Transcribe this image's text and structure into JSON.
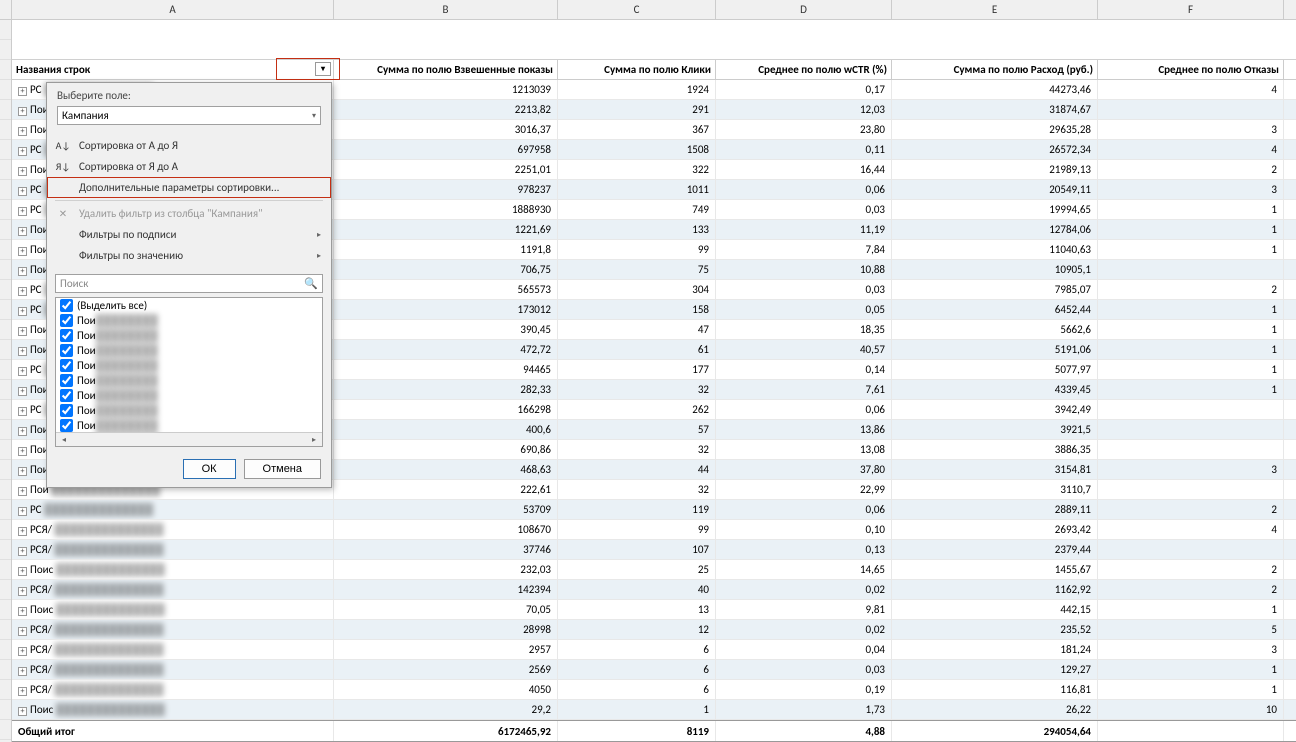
{
  "col_letters": [
    "",
    "A",
    "B",
    "C",
    "D",
    "E",
    "F"
  ],
  "col_widths": [
    "12px",
    "322px",
    "224px",
    "158px",
    "176px",
    "206px",
    "186px"
  ],
  "pivot_header": {
    "row_labels": "Названия строк",
    "B": "Сумма по полю Взвешенные показы",
    "C": "Сумма по полю Клики",
    "D": "Среднее по полю wCTR (%)",
    "E": "Сумма по полю Расход (руб.)",
    "F": "Среднее по полю Отказы"
  },
  "rows": [
    {
      "a": "РС",
      "v": [
        "1213039",
        "1924",
        "0,17",
        "44273,46",
        "4"
      ]
    },
    {
      "a": "Пои",
      "v": [
        "2213,82",
        "291",
        "12,03",
        "31874,67",
        ""
      ]
    },
    {
      "a": "Пои",
      "v": [
        "3016,37",
        "367",
        "23,80",
        "29635,28",
        "3"
      ]
    },
    {
      "a": "РС",
      "v": [
        "697958",
        "1508",
        "0,11",
        "26572,34",
        "4"
      ]
    },
    {
      "a": "Пои",
      "v": [
        "2251,01",
        "322",
        "16,44",
        "21989,13",
        "2"
      ]
    },
    {
      "a": "РС",
      "v": [
        "978237",
        "1011",
        "0,06",
        "20549,11",
        "3"
      ]
    },
    {
      "a": "РС",
      "v": [
        "1888930",
        "749",
        "0,03",
        "19994,65",
        "1"
      ]
    },
    {
      "a": "Пои",
      "v": [
        "1221,69",
        "133",
        "11,19",
        "12784,06",
        "1"
      ]
    },
    {
      "a": "Пои",
      "v": [
        "1191,8",
        "99",
        "7,84",
        "11040,63",
        "1"
      ]
    },
    {
      "a": "Пои",
      "v": [
        "706,75",
        "75",
        "10,88",
        "10905,1",
        ""
      ]
    },
    {
      "a": "РС",
      "v": [
        "565573",
        "304",
        "0,03",
        "7985,07",
        "2"
      ]
    },
    {
      "a": "РС",
      "v": [
        "173012",
        "158",
        "0,05",
        "6452,44",
        "1"
      ]
    },
    {
      "a": "Пои",
      "v": [
        "390,45",
        "47",
        "18,35",
        "5662,6",
        "1"
      ]
    },
    {
      "a": "Пои",
      "v": [
        "472,72",
        "61",
        "40,57",
        "5191,06",
        "1"
      ]
    },
    {
      "a": "РС",
      "v": [
        "94465",
        "177",
        "0,14",
        "5077,97",
        "1"
      ]
    },
    {
      "a": "Пои",
      "v": [
        "282,33",
        "32",
        "7,61",
        "4339,45",
        "1"
      ]
    },
    {
      "a": "РС",
      "v": [
        "166298",
        "262",
        "0,06",
        "3942,49",
        ""
      ]
    },
    {
      "a": "Пои",
      "v": [
        "400,6",
        "57",
        "13,86",
        "3921,5",
        ""
      ]
    },
    {
      "a": "Пои",
      "v": [
        "690,86",
        "32",
        "13,08",
        "3886,35",
        ""
      ]
    },
    {
      "a": "Пои",
      "v": [
        "468,63",
        "44",
        "37,80",
        "3154,81",
        "3"
      ]
    },
    {
      "a": "Пои",
      "v": [
        "222,61",
        "32",
        "22,99",
        "3110,7",
        ""
      ]
    },
    {
      "a": "РС",
      "v": [
        "53709",
        "119",
        "0,06",
        "2889,11",
        "2"
      ]
    },
    {
      "a": "РСЯ/",
      "v": [
        "108670",
        "99",
        "0,10",
        "2693,42",
        "4"
      ]
    },
    {
      "a": "РСЯ/",
      "v": [
        "37746",
        "107",
        "0,13",
        "2379,44",
        ""
      ]
    },
    {
      "a": "Поис",
      "v": [
        "232,03",
        "25",
        "14,65",
        "1455,67",
        "2"
      ]
    },
    {
      "a": "РСЯ/",
      "v": [
        "142394",
        "40",
        "0,02",
        "1162,92",
        "2"
      ]
    },
    {
      "a": "Поис",
      "v": [
        "70,05",
        "13",
        "9,81",
        "442,15",
        "1"
      ]
    },
    {
      "a": "РСЯ/",
      "v": [
        "28998",
        "12",
        "0,02",
        "235,52",
        "5"
      ]
    },
    {
      "a": "РСЯ/",
      "v": [
        "2957",
        "6",
        "0,04",
        "181,24",
        "3"
      ]
    },
    {
      "a": "РСЯ/",
      "v": [
        "2569",
        "6",
        "0,03",
        "129,27",
        "1"
      ]
    },
    {
      "a": "РСЯ/",
      "v": [
        "4050",
        "6",
        "0,19",
        "116,81",
        "1"
      ]
    },
    {
      "a": "Поис",
      "v": [
        "29,2",
        "1",
        "1,73",
        "26,22",
        "10"
      ]
    }
  ],
  "total": {
    "label": "Общий итог",
    "v": [
      "6172465,92",
      "8119",
      "4,88",
      "294054,64",
      ""
    ]
  },
  "dropdown": {
    "select_field_label": "Выберите поле:",
    "field_value": "Кампания",
    "sort_az": "Сортировка от А до Я",
    "sort_za": "Сортировка от Я до А",
    "more_sort": "Дополнительные параметры сортировки...",
    "clear_filter": "Удалить фильтр из столбца \"Кампания\"",
    "label_filters": "Фильтры по подписи",
    "value_filters": "Фильтры по значению",
    "search_placeholder": "Поиск",
    "select_all": "(Выделить все)",
    "items": [
      "Пои",
      "Пои",
      "Пои",
      "Пои",
      "Пои",
      "Пои",
      "Пои",
      "Пои",
      "Пои"
    ],
    "ok": "ОК",
    "cancel": "Отмена"
  }
}
